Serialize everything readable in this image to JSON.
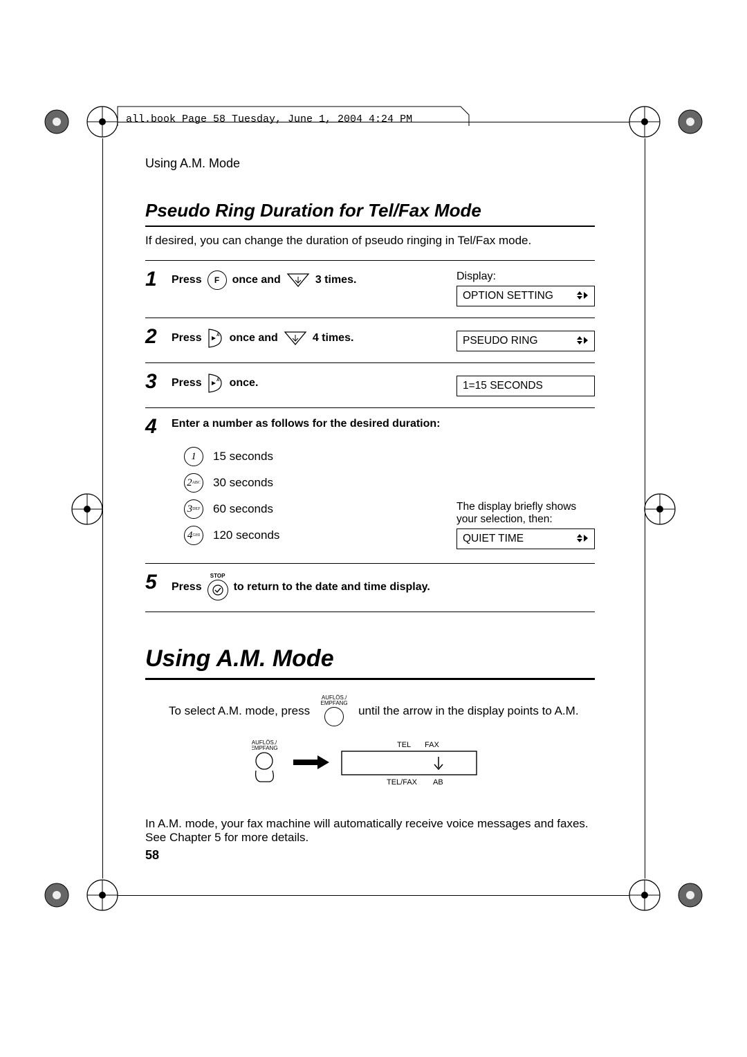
{
  "book_tag": "all.book  Page 58  Tuesday, June 1, 2004  4:24 PM",
  "running_head": "Using A.M. Mode",
  "section_title": "Pseudo Ring Duration for Tel/Fax Mode",
  "intro": "If desired, you can change the duration of pseudo ringing in Tel/Fax mode.",
  "display_label": "Display:",
  "steps": {
    "s1_press": "Press",
    "s1_once_and": "once and",
    "s1_times": "3 times.",
    "s1_lcd": "OPTION SETTING",
    "s2_press": "Press",
    "s2_once_and": "once and",
    "s2_times": "4 times.",
    "s2_lcd": "PSEUDO RING",
    "s3_press": "Press",
    "s3_once": "once.",
    "s3_lcd": "1=15 SECONDS",
    "s4_text": "Enter a number as follows for the desired duration:",
    "s4_note1": "The display briefly shows your selection, then:",
    "s4_lcd": "QUIET TIME",
    "options": [
      {
        "key": "1",
        "sub": "",
        "label": "15 seconds"
      },
      {
        "key": "2",
        "sub": "ABC",
        "label": "30 seconds"
      },
      {
        "key": "3",
        "sub": "DEF",
        "label": "60 seconds"
      },
      {
        "key": "4",
        "sub": "GHI",
        "label": "120 seconds"
      }
    ],
    "s5_press": "Press",
    "s5_stop": "STOP",
    "s5_rest": "to return to the date and time display."
  },
  "heading2": "Using A.M. Mode",
  "para2_a": "To select A.M. mode, press",
  "para2_key_label": "AUFLÖS./ EMPFANG",
  "para2_b": "until the arrow in the display points to A.M.",
  "diagram": {
    "key_label": "AUFLÖS./ EMPFANG",
    "top_left": "TEL",
    "top_right": "FAX",
    "bottom_left": "TEL/FAX",
    "bottom_right": "AB"
  },
  "para3": "In A.M. mode, your fax machine will automatically receive voice messages and faxes. See Chapter 5 for more details.",
  "page_number": "58"
}
